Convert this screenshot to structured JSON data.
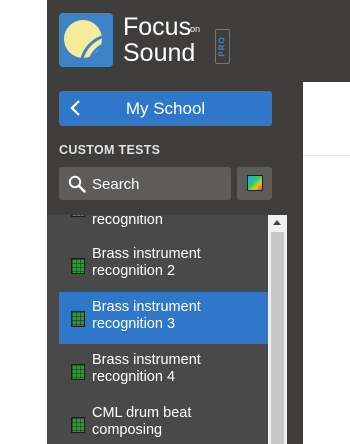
{
  "brand": {
    "word1": "Focus",
    "on": "on",
    "word2": "Sound",
    "badge": "PRO"
  },
  "nav": {
    "school_label": "My School"
  },
  "custom_tests": {
    "section_title": "CUSTOM TESTS",
    "search_placeholder": "Search"
  },
  "list": {
    "items": [
      {
        "label": "recognition",
        "active": false
      },
      {
        "label": "Brass instrument recognition 2",
        "active": false
      },
      {
        "label": "Brass instrument recognition 3",
        "active": true
      },
      {
        "label": "Brass instrument recognition 4",
        "active": false
      },
      {
        "label": "CML drum beat composing",
        "active": false
      }
    ]
  },
  "colors": {
    "accent": "#2f78c9",
    "sidebar": "#4a4949",
    "header": "#3f3e3d"
  }
}
